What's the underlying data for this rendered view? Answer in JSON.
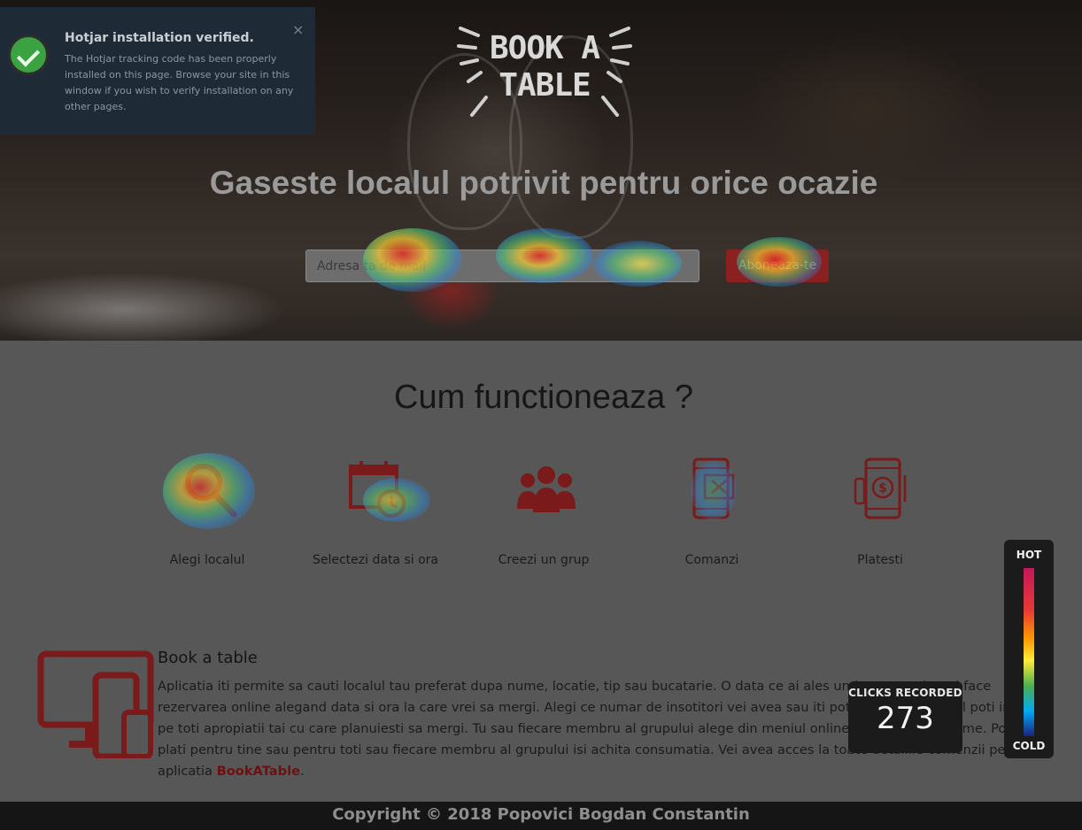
{
  "hotjar": {
    "title": "Hotjar installation verified.",
    "body": "The Hotjar tracking code has been properly installed on this page. Browse your site in this window if you wish to verify installation on any other pages.",
    "close": "×"
  },
  "hero": {
    "logo_line1": "BOOK A",
    "logo_line2": "TABLE",
    "title": "Gaseste localul potrivit pentru orice ocazie",
    "email_placeholder": "Adresa ta de mail",
    "subscribe_label": "Aboneaza-te"
  },
  "how": {
    "title": "Cum functioneaza ?",
    "steps": [
      {
        "label": "Alegi localul",
        "icon": "search-icon"
      },
      {
        "label": "Selectezi data si ora",
        "icon": "calendar-clock-icon"
      },
      {
        "label": "Creezi un grup",
        "icon": "group-icon"
      },
      {
        "label": "Comanzi",
        "icon": "phone-order-icon"
      },
      {
        "label": "Platesti",
        "icon": "phone-payment-icon"
      }
    ]
  },
  "about": {
    "title": "Book a table",
    "text": "Aplicatia iti permite sa cauti localul tau preferat dupa nume, locatie, tip sau bucatarie. O data ce ai ales unde sa mergi, poti face rezervarea online alegand data si ora la care vrei sa mergi. Alegi ce numar de insotitori vei avea sau iti poti face un grup si il poti invita pe toti apropiatii tai cu care planuiesti sa mergi. Tu sau fiecare membru al grupului alege din meniul online ce vrea sa consume. Poti plati pentru tine sau pentru toti sau fiecare membru al grupului isi achita consumatia. Vei avea acces la toate detaliile comenzii pe aplicatia ",
    "brand": "BookATable",
    "end": "."
  },
  "footer": {
    "text": "Copyright © 2018 Popovici Bogdan Constantin"
  },
  "heatmap": {
    "clicks_label": "CLICKS RECORDED",
    "clicks_count": "273",
    "legend_hot": "HOT",
    "legend_cold": "COLD"
  },
  "colors": {
    "accent": "#8a2020",
    "icon_red": "#7a1a1a",
    "footer_bg": "#151515"
  }
}
